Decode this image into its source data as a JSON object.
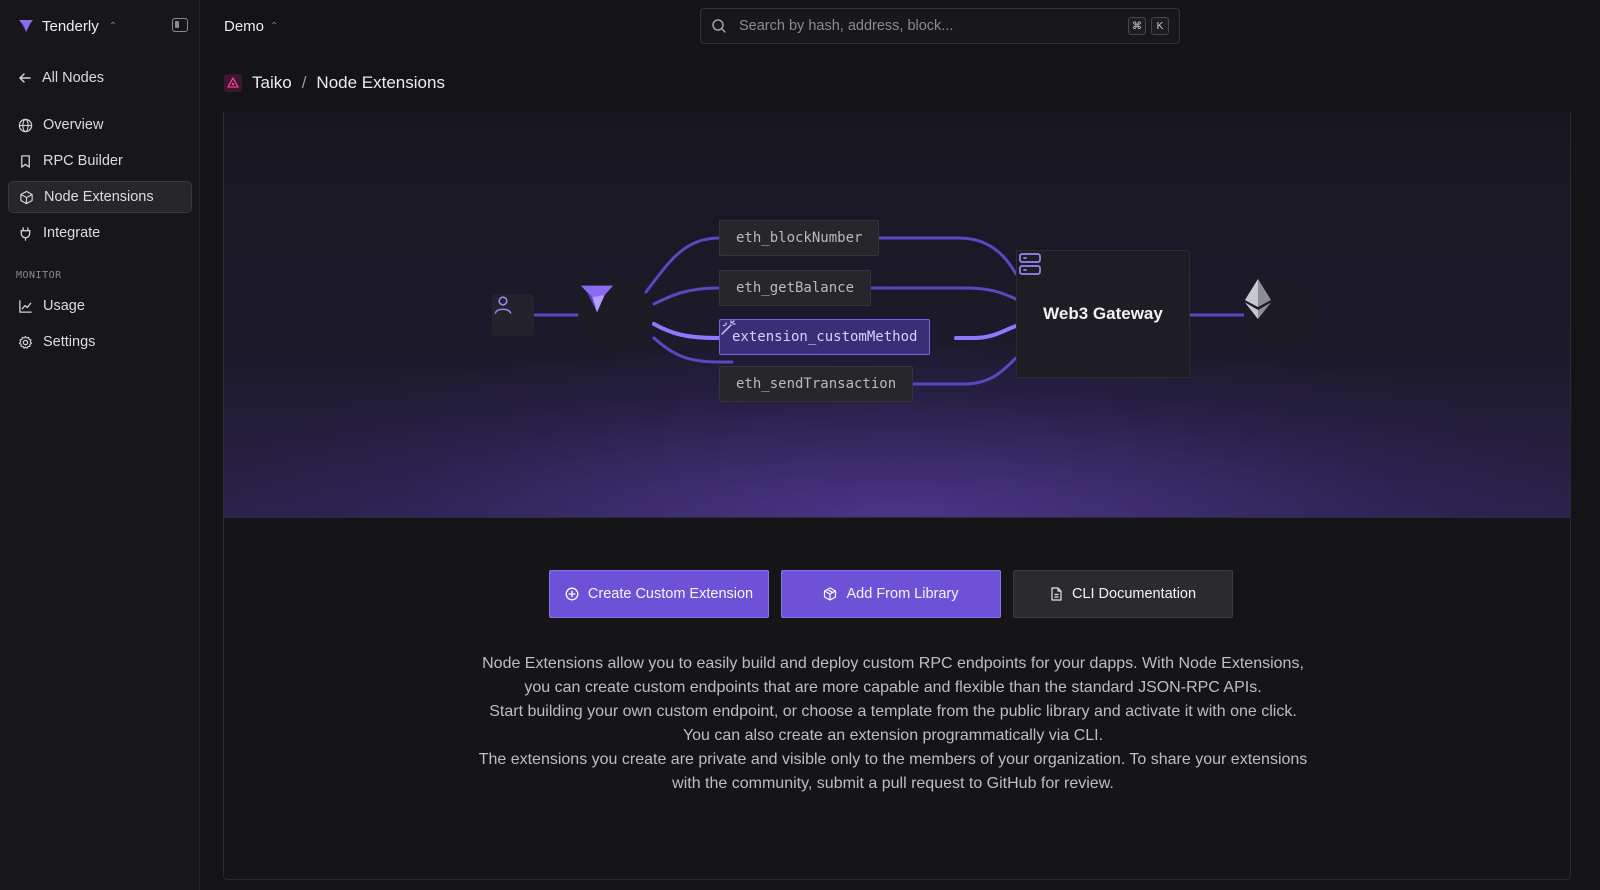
{
  "sidebar": {
    "brand": "Tenderly",
    "back_label": "All Nodes",
    "items": [
      {
        "label": "Overview"
      },
      {
        "label": "RPC Builder"
      },
      {
        "label": "Node Extensions"
      },
      {
        "label": "Integrate"
      }
    ],
    "monitor_label": "MONITOR",
    "monitor_items": [
      {
        "label": "Usage"
      },
      {
        "label": "Settings"
      }
    ]
  },
  "topbar": {
    "workspace": "Demo",
    "search_placeholder": "Search by hash, address, block...",
    "shortcut_keys": [
      "⌘",
      "K"
    ]
  },
  "breadcrumb": {
    "network": "Taiko",
    "separator": "/",
    "page": "Node Extensions"
  },
  "hero": {
    "methods": [
      "eth_blockNumber",
      "eth_getBalance",
      "extension_customMethod",
      "eth_sendTransaction"
    ],
    "gateway_label": "Web3 Gateway"
  },
  "actions": {
    "create_label": "Create Custom Extension",
    "library_label": "Add From Library",
    "cli_label": "CLI Documentation"
  },
  "description": {
    "p1": "Node Extensions allow you to easily build and deploy custom RPC endpoints for your dapps. With Node Extensions, you can create custom endpoints that are more capable and flexible than the standard JSON-RPC APIs.",
    "p2": "Start building your own custom endpoint, or choose a template from the public library and activate it with one click. You can also create an extension programmatically via CLI.",
    "p3": "The extensions you create are private and visible only to the members of your organization. To share your extensions with the community, submit a pull request to GitHub for review."
  },
  "colors": {
    "accent": "#6d52d8",
    "highlight_border": "#7a62e6",
    "background": "#141416"
  }
}
